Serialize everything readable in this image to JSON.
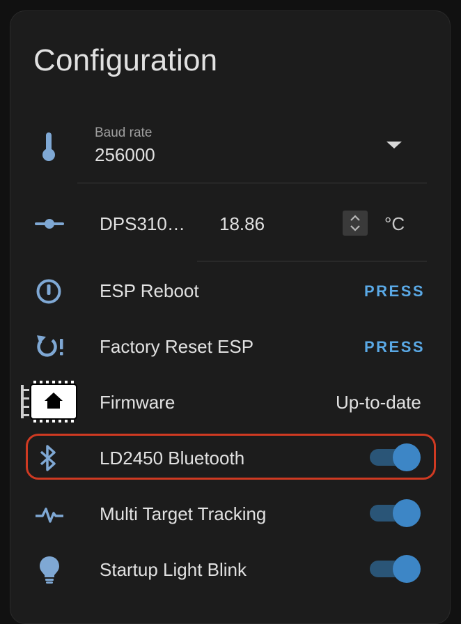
{
  "card": {
    "title": "Configuration"
  },
  "baud_rate": {
    "label": "Baud rate",
    "value": "256000",
    "icon": "thermometer-icon"
  },
  "temperature_offset": {
    "label": "DPS310…",
    "value": "18.86",
    "unit": "°C",
    "icon": "slider-icon"
  },
  "esp_reboot": {
    "label": "ESP Reboot",
    "action": "PRESS",
    "icon": "power-icon"
  },
  "factory_reset": {
    "label": "Factory Reset ESP",
    "action": "PRESS",
    "icon": "restart-alert-icon"
  },
  "firmware": {
    "label": "Firmware",
    "status": "Up-to-date",
    "icon": "esphome-chip-icon"
  },
  "ld2450_bluetooth": {
    "label": "LD2450 Bluetooth",
    "state": "on",
    "icon": "bluetooth-icon"
  },
  "multi_target_tracking": {
    "label": "Multi Target Tracking",
    "state": "on",
    "icon": "pulse-icon"
  },
  "startup_light_blink": {
    "label": "Startup Light Blink",
    "state": "on",
    "icon": "lightbulb-icon"
  },
  "colors": {
    "background": "#111111",
    "card": "#1c1c1c",
    "icon": "#7fa8d4",
    "accent": "#5aa9e6",
    "toggle_knob": "#3d86c6",
    "toggle_track": "#2a5577",
    "highlight": "#cf3a22"
  }
}
